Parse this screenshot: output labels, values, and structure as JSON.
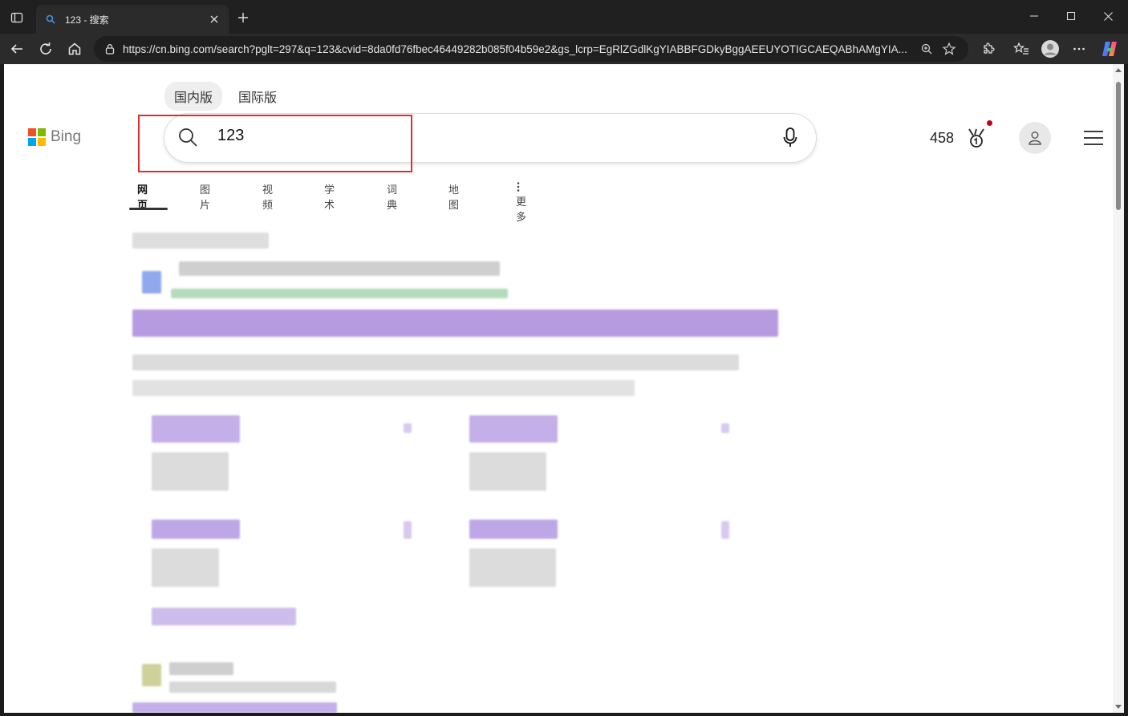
{
  "browser": {
    "tab_title": "123 - 搜索",
    "url": "https://cn.bing.com/search?pglt=297&q=123&cvid=8da0fd76fbec46449282b085f04b59e2&gs_lcrp=EgRlZGdlKgYIABBFGDkyBggAEEUYOTIGCAEQABhAMgYIA..."
  },
  "icons": {
    "tab_actions": "tab-actions-icon",
    "favicon": "search-favicon-icon",
    "tab_close": "close-icon",
    "new_tab": "plus-icon",
    "back": "back-arrow-icon",
    "refresh": "refresh-icon",
    "home": "home-icon",
    "lock": "lock-icon",
    "zoom": "zoom-icon",
    "favorite": "star-icon",
    "extensions": "puzzle-icon",
    "favorites": "favorites-list-icon",
    "profile": "profile-icon",
    "more": "more-icon",
    "copilot": "copilot-icon"
  },
  "bing": {
    "markets": [
      "国内版",
      "国际版"
    ],
    "active_market": "国内版",
    "logo_text": "Bing",
    "query": "123",
    "rewards_count": "458",
    "nav_tabs": [
      "网页",
      "图片",
      "视频",
      "学术",
      "词典",
      "地图",
      "更多"
    ],
    "active_tab": "网页",
    "colors": {
      "highlight_box": "#e22c2c",
      "rewards_dot": "#c4001a",
      "ms_red": "#f25022",
      "ms_green": "#7fba00",
      "ms_blue": "#00a4ef",
      "ms_yellow": "#ffb900"
    }
  }
}
